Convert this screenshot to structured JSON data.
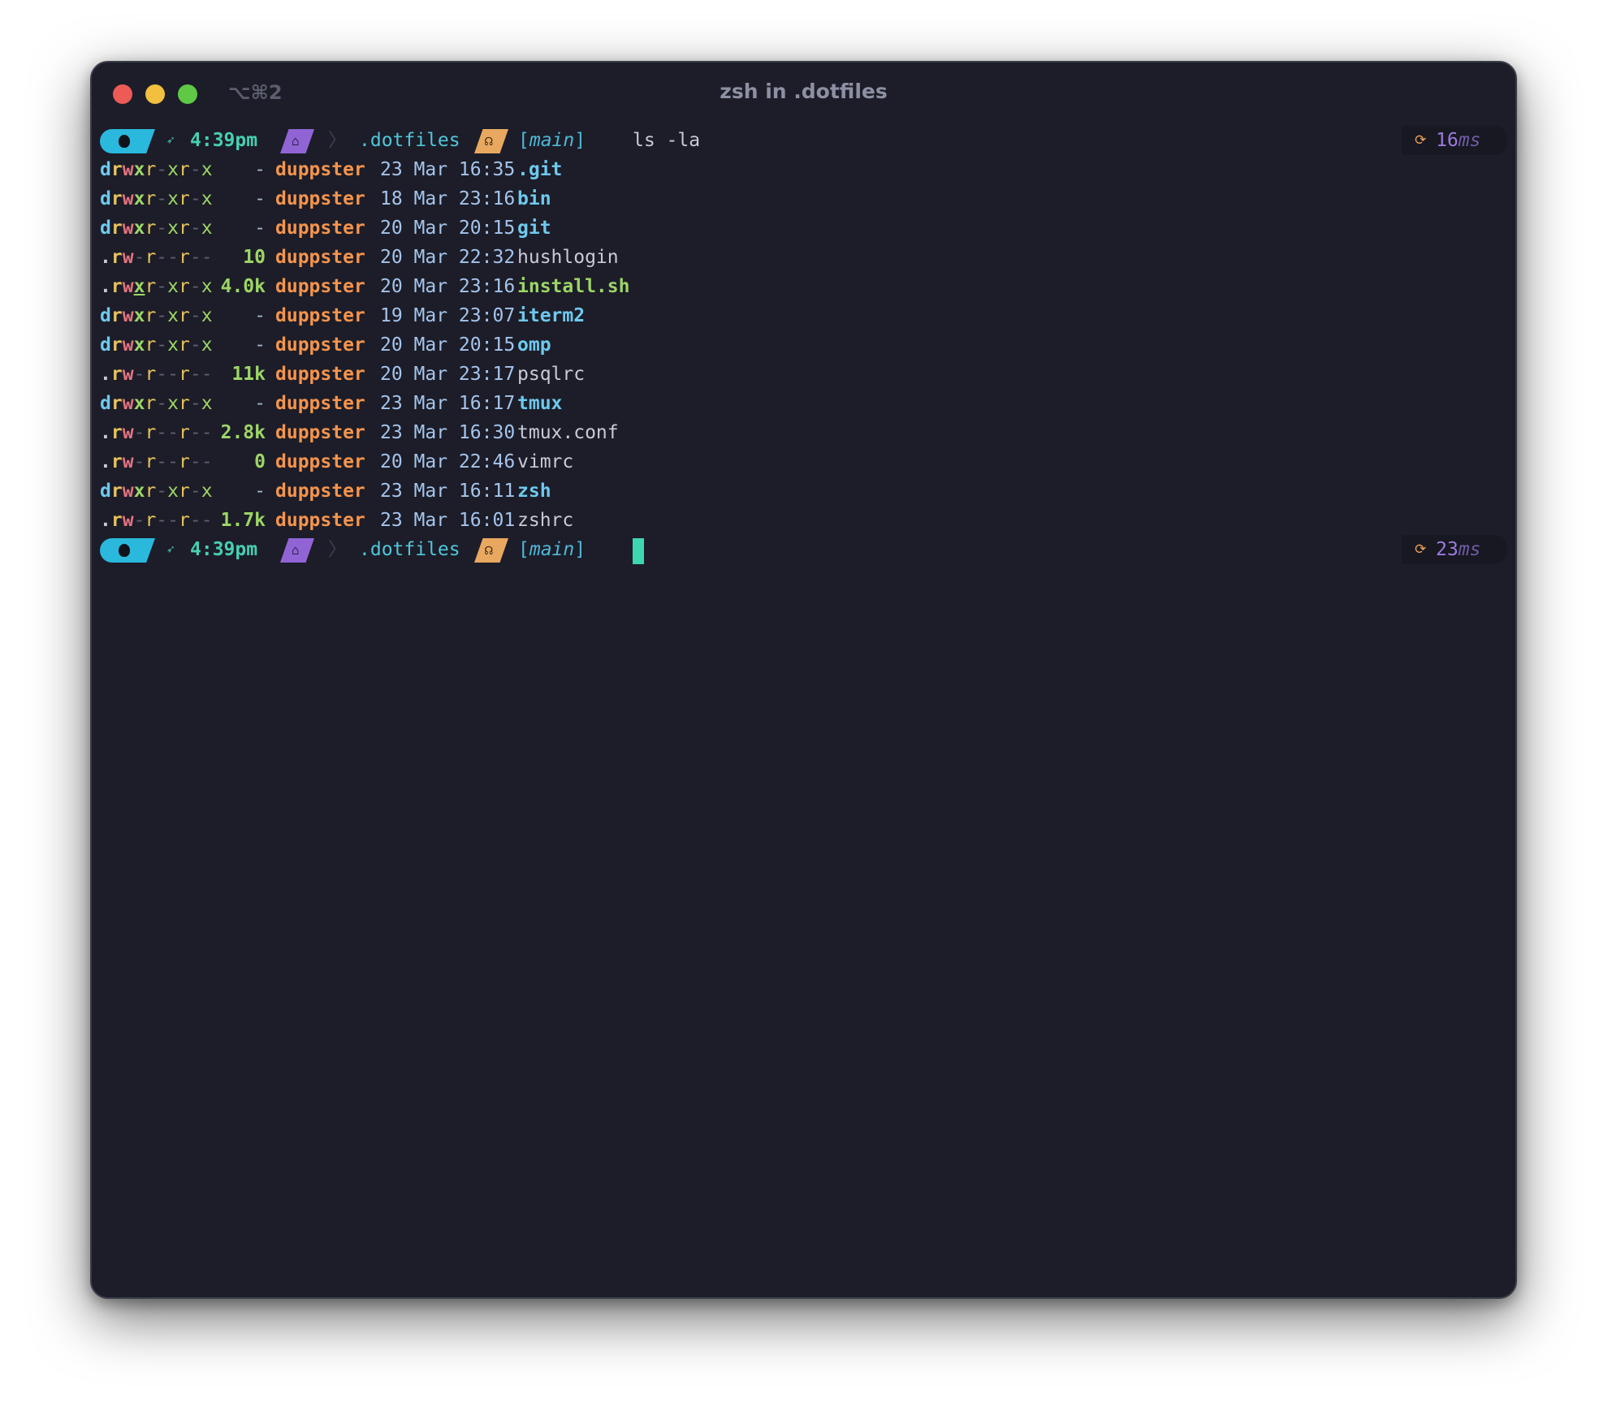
{
  "window": {
    "title": "zsh in .dotfiles",
    "shortcut": "⌥⌘2"
  },
  "prompt1": {
    "time": "4:39pm",
    "dir": ".dotfiles",
    "branch_open": "[",
    "branch": "main",
    "branch_close": "]",
    "command": "ls -la",
    "duration_value": "16",
    "duration_unit": "ms"
  },
  "prompt2": {
    "time": "4:39pm",
    "dir": ".dotfiles",
    "branch_open": "[",
    "branch": "main",
    "branch_close": "]",
    "duration_value": "23",
    "duration_unit": "ms"
  },
  "listing": [
    {
      "type": "d",
      "perm": "drwxr-xr-x",
      "size": "-",
      "user": "duppster",
      "date": "23 Mar 16:35",
      "name": ".git",
      "kind": "dir"
    },
    {
      "type": "d",
      "perm": "drwxr-xr-x",
      "size": "-",
      "user": "duppster",
      "date": "18 Mar 23:16",
      "name": "bin",
      "kind": "dir"
    },
    {
      "type": "d",
      "perm": "drwxr-xr-x",
      "size": "-",
      "user": "duppster",
      "date": "20 Mar 20:15",
      "name": "git",
      "kind": "dir"
    },
    {
      "type": "f",
      "perm": ".rw-r--r--",
      "size": "10",
      "user": "duppster",
      "date": "20 Mar 22:32",
      "name": "hushlogin",
      "kind": "file"
    },
    {
      "type": "x",
      "perm": ".rwxr-xr-x",
      "size": "4.0k",
      "user": "duppster",
      "date": "20 Mar 23:16",
      "name": "install.sh",
      "kind": "exec"
    },
    {
      "type": "d",
      "perm": "drwxr-xr-x",
      "size": "-",
      "user": "duppster",
      "date": "19 Mar 23:07",
      "name": "iterm2",
      "kind": "dir"
    },
    {
      "type": "d",
      "perm": "drwxr-xr-x",
      "size": "-",
      "user": "duppster",
      "date": "20 Mar 20:15",
      "name": "omp",
      "kind": "dir"
    },
    {
      "type": "f",
      "perm": ".rw-r--r--",
      "size": "11k",
      "user": "duppster",
      "date": "20 Mar 23:17",
      "name": "psqlrc",
      "kind": "file"
    },
    {
      "type": "d",
      "perm": "drwxr-xr-x",
      "size": "-",
      "user": "duppster",
      "date": "23 Mar 16:17",
      "name": "tmux",
      "kind": "dir"
    },
    {
      "type": "f",
      "perm": ".rw-r--r--",
      "size": "2.8k",
      "user": "duppster",
      "date": "23 Mar 16:30",
      "name": "tmux.conf",
      "kind": "file"
    },
    {
      "type": "f",
      "perm": ".rw-r--r--",
      "size": "0",
      "user": "duppster",
      "date": "20 Mar 22:46",
      "name": "vimrc",
      "kind": "file"
    },
    {
      "type": "d",
      "perm": "drwxr-xr-x",
      "size": "-",
      "user": "duppster",
      "date": "23 Mar 16:11",
      "name": "zsh",
      "kind": "dir"
    },
    {
      "type": "f",
      "perm": ".rw-r--r--",
      "size": "1.7k",
      "user": "duppster",
      "date": "23 Mar 16:01",
      "name": "zshrc",
      "kind": "file"
    }
  ],
  "icons": {
    "apple": "apple-icon",
    "time": "rocket-icon",
    "home": "home-icon",
    "git": "github-icon",
    "timer": "timer-icon"
  }
}
